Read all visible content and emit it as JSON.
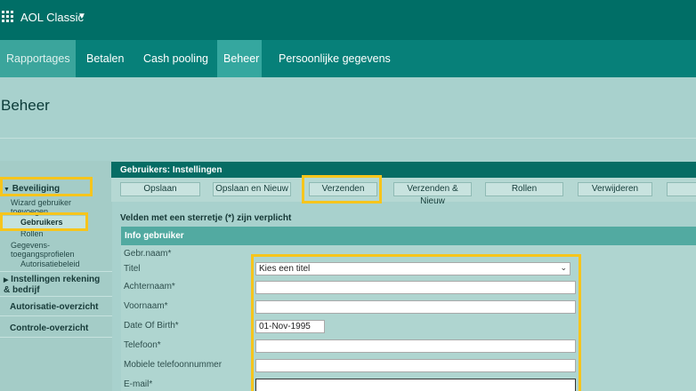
{
  "app": {
    "title": "AOL Classic"
  },
  "nav": {
    "tabs": [
      "Rapportages",
      "Betalen",
      "Cash pooling",
      "Beheer",
      "Persoonlijke gegevens"
    ]
  },
  "page": {
    "title": "Beheer"
  },
  "sidebar": {
    "section_security": "Beveiliging",
    "items": [
      "Wizard gebruiker toevoegen",
      "Gebruikers",
      "Rollen",
      "Gegevens-toegangsprofielen",
      "Autorisatiebeleid"
    ],
    "section_account": "Instellingen rekening & bedrijf",
    "section_authorization": "Autorisatie-overzicht",
    "section_control": "Controle-overzicht"
  },
  "panel": {
    "title": "Gebruikers: Instellingen"
  },
  "toolbar": {
    "save": "Opslaan",
    "save_new": "Opslaan en Nieuw",
    "send": "Verzenden",
    "send_new": "Verzenden & Nieuw",
    "roles": "Rollen",
    "delete": "Verwijderen"
  },
  "form": {
    "required_note": "Velden met een sterretje (*) zijn verplicht",
    "section_title": "Info gebruiker",
    "labels": {
      "username": "Gebr.naam*",
      "title": "Titel",
      "lastname": "Achternaam*",
      "firstname": "Voornaam*",
      "dob": "Date Of Birth*",
      "phone": "Telefoon*",
      "mobile": "Mobiele telefoonnummer",
      "email": "E-mail*"
    },
    "values": {
      "title_selected": "Kies een titel",
      "dob": "01-Nov-1995",
      "lastname": "",
      "firstname": "",
      "phone": "",
      "mobile": "",
      "email": ""
    }
  },
  "colors": {
    "highlight": "#f6c51c",
    "topbar": "#006e66",
    "nav": "#078079"
  }
}
